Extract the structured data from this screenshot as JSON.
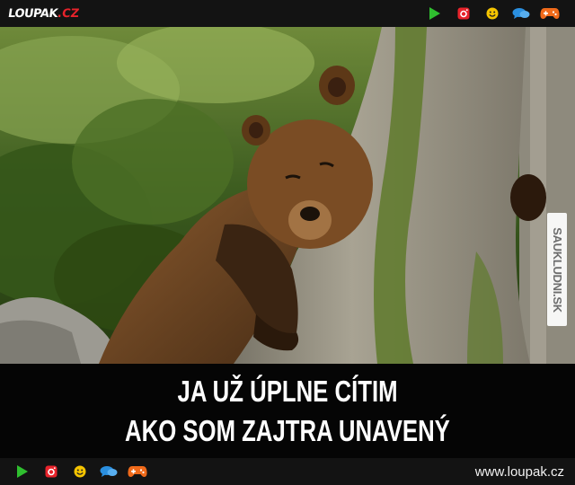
{
  "brand": {
    "logo_text": "LOUPAK",
    "logo_domain": ".CZ",
    "accent_color": "#e8232b"
  },
  "top_icons": [
    "play-icon",
    "instagram-icon",
    "smiley-icon",
    "chat-icon",
    "gamepad-icon"
  ],
  "bottom_icons": [
    "play-icon",
    "instagram-icon",
    "smiley-icon",
    "chat-icon",
    "gamepad-icon"
  ],
  "icon_colors": {
    "play": "#2fbf2f",
    "instagram": "#e8232b",
    "smiley": "#f5c400",
    "chat": "#2a8fe0",
    "gamepad": "#f06a1a"
  },
  "photo": {
    "subject": "bear-leaning-on-tree",
    "watermark": "SAUKLUDNI.SK"
  },
  "caption": {
    "line1": "JA UŽ ÚPLNE CÍTIM",
    "line2": "AKO SOM ZAJTRA UNAVENÝ"
  },
  "footer": {
    "url": "www.loupak.cz"
  }
}
